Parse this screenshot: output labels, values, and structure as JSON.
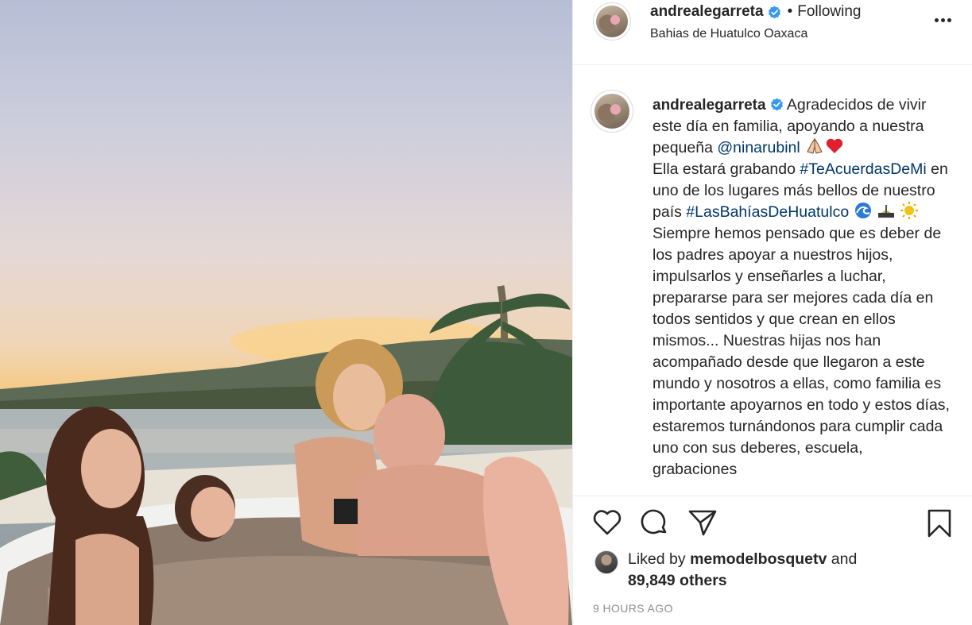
{
  "post": {
    "username": "andrealegarreta",
    "follow_separator": "•",
    "follow_status": "Following",
    "location": "Bahias de Huatulco Oaxaca",
    "caption": {
      "username": "andrealegarreta",
      "text_1": "Agradecidos de vivir este día en familia, apoyando a nuestra pequeña ",
      "mention": "@ninarubinl",
      "text_2": "Ella estará grabando ",
      "hashtag_1": "#TeAcuerdasDeMi",
      "text_3": " en uno de los lugares más bellos de nuestro país ",
      "hashtag_2": "#LasBahíasDeHuatulco",
      "text_4": "Siempre hemos pensado que es deber de los padres apoyar a nuestros hijos, impulsarlos y enseñarles a luchar, prepararse para ser mejores cada día en todos sentidos y que crean en ellos mismos... Nuestras hijas nos han acompañado desde que llegaron a este mundo y nosotros a ellas, como familia es importante apoyarnos en todo y estos días, estaremos turnándonos para cumplir cada uno con sus deberes, escuela, grabaciones"
    },
    "likes": {
      "prefix": "Liked by ",
      "liker": "memodelbosquetv",
      "conjunction": " and",
      "others": "89,849 others"
    },
    "timestamp": "9 HOURS AGO"
  },
  "icons": {
    "verified": "verified-badge-icon",
    "more": "more-options-icon",
    "like": "heart-icon",
    "comment": "comment-icon",
    "share": "paper-plane-icon",
    "save": "bookmark-icon"
  },
  "colors": {
    "verified_blue": "#3897f0",
    "link_blue": "#00376b",
    "text": "#262626",
    "muted": "#8e8e8e",
    "border": "#efefef"
  }
}
